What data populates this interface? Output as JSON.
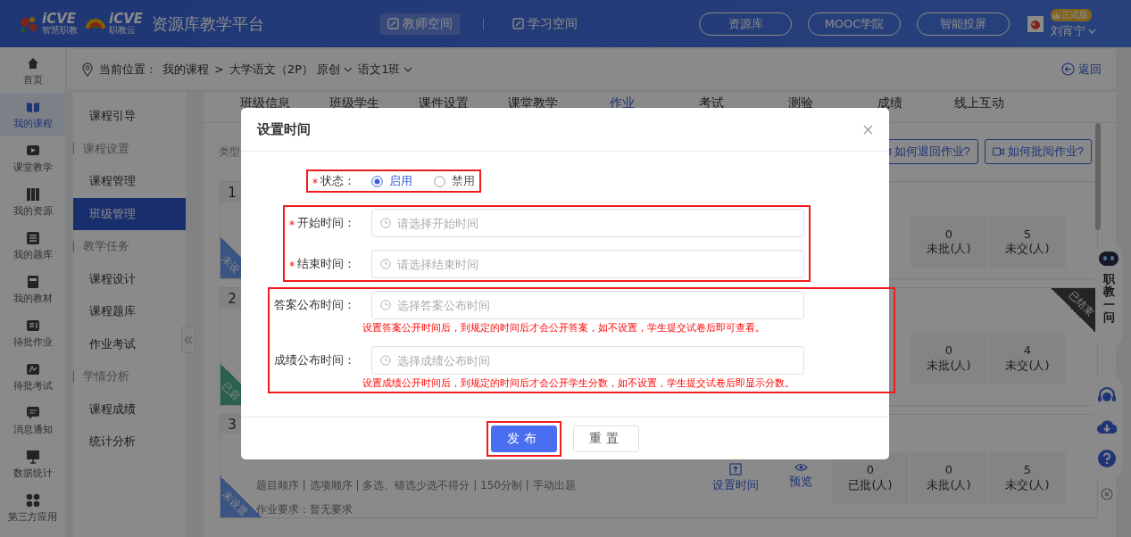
{
  "header": {
    "logos": [
      {
        "mark": "iCVE",
        "caption": "智慧职教"
      },
      {
        "mark": "iCVE",
        "caption": "职教云"
      }
    ],
    "title": "资源库教学平台",
    "spaces": [
      {
        "label": "教师空间",
        "selected": true
      },
      {
        "label": "学习空间",
        "selected": false
      }
    ],
    "links": [
      "资源库",
      "MOOC学院",
      "智能投屏"
    ],
    "badge": "正式版",
    "user": "刘宵宁"
  },
  "nav_rail": [
    {
      "label": "首页",
      "selected": false
    },
    {
      "label": "我的课程",
      "selected": true
    },
    {
      "label": "课堂教学",
      "selected": false
    },
    {
      "label": "我的资源",
      "selected": false
    },
    {
      "label": "我的题库",
      "selected": false
    },
    {
      "label": "我的教材",
      "selected": false
    },
    {
      "label": "待批作业",
      "selected": false
    },
    {
      "label": "待批考试",
      "selected": false
    },
    {
      "label": "消息通知",
      "selected": false
    },
    {
      "label": "数据统计",
      "selected": false
    },
    {
      "label": "第三方应用",
      "selected": false
    }
  ],
  "breadcrumb": {
    "label": "当前位置：",
    "crumbs": [
      {
        "text": "我的课程",
        "kind": "link"
      },
      {
        "text": ">",
        "kind": "separator"
      },
      {
        "text": "大学语文（2P） 原创",
        "kind": "dropdown"
      },
      {
        "text": "语文1班",
        "kind": "dropdown"
      }
    ],
    "back": "返回"
  },
  "course_menu": [
    {
      "label": "课程引导",
      "kind": "item",
      "selected": false
    },
    {
      "label": "课程设置",
      "kind": "section"
    },
    {
      "label": "课程管理",
      "kind": "item",
      "selected": false
    },
    {
      "label": "班级管理",
      "kind": "item",
      "selected": true
    },
    {
      "label": "教学任务",
      "kind": "section"
    },
    {
      "label": "课程设计",
      "kind": "item",
      "selected": false
    },
    {
      "label": "课程题库",
      "kind": "item",
      "selected": false
    },
    {
      "label": "作业考试",
      "kind": "item",
      "selected": false
    },
    {
      "label": "学情分析",
      "kind": "section"
    },
    {
      "label": "课程成绩",
      "kind": "item",
      "selected": false
    },
    {
      "label": "统计分析",
      "kind": "item",
      "selected": false
    }
  ],
  "tabs": [
    {
      "label": "班级信息",
      "selected": false
    },
    {
      "label": "班级学生",
      "selected": false
    },
    {
      "label": "课件设置",
      "selected": false
    },
    {
      "label": "课堂教学",
      "selected": false
    },
    {
      "label": "作业",
      "selected": true
    },
    {
      "label": "考试",
      "selected": false
    },
    {
      "label": "测验",
      "selected": false
    },
    {
      "label": "成绩",
      "selected": false
    },
    {
      "label": "线上互动",
      "selected": false
    }
  ],
  "toolbar": {
    "filter_label": "类型",
    "help_buttons": [
      "如何退回作业?",
      "如何批阅作业?"
    ]
  },
  "cards": [
    {
      "number": "1",
      "ribbon": {
        "text": "未设",
        "kind": "unset"
      },
      "stats": [
        {
          "value": "0",
          "label": "未批(人)"
        },
        {
          "value": "5",
          "label": "未交(人)"
        }
      ]
    },
    {
      "number": "2",
      "ribbon": {
        "text": "已启",
        "kind": "enabled"
      },
      "corner": "已结束",
      "stats": [
        {
          "value": "0",
          "label": "未批(人)"
        },
        {
          "value": "4",
          "label": "未交(人)"
        }
      ]
    },
    {
      "number": "3",
      "ribbon": {
        "text": "未设置",
        "kind": "unset"
      },
      "details": "题目顺序 | 选项顺序 | 多选、错选少选不得分 | 150分制 | 手动出题",
      "requirement": "作业要求：暂无要求",
      "actions": [
        "设置时间",
        "预览"
      ],
      "stats": [
        {
          "value": "0",
          "label": "已批(人)"
        },
        {
          "value": "0",
          "label": "未批(人)"
        },
        {
          "value": "5",
          "label": "未交(人)"
        }
      ]
    }
  ],
  "assistant": {
    "label": "职教一问"
  },
  "dialog": {
    "title": "设置时间",
    "groups": [
      {
        "highlighted": true,
        "rows": [
          {
            "kind": "radio",
            "label": "状态：",
            "required": true,
            "options": [
              {
                "label": "启用",
                "selected": true
              },
              {
                "label": "禁用",
                "selected": false
              }
            ]
          }
        ]
      },
      {
        "highlighted": true,
        "rows": [
          {
            "kind": "time",
            "label": "开始时间：",
            "required": true,
            "placeholder": "请选择开始时间"
          },
          {
            "kind": "time",
            "label": "结束时间：",
            "required": true,
            "placeholder": "请选择结束时间"
          }
        ]
      },
      {
        "highlighted": true,
        "rows": [
          {
            "kind": "time",
            "label": "答案公布时间：",
            "required": false,
            "placeholder": "选择答案公布时间",
            "hint": "设置答案公开时间后，到规定的时间后才会公开答案，如不设置，学生提交试卷后即可查看。"
          },
          {
            "kind": "time",
            "label": "成绩公布时间：",
            "required": false,
            "placeholder": "选择成绩公布时间",
            "hint": "设置成绩公开时间后，到规定的时间后才会公开学生分数，如不设置，学生提交试卷后即显示分数。"
          }
        ]
      }
    ],
    "buttons": [
      {
        "label": "发布",
        "kind": "primary",
        "highlighted": true
      },
      {
        "label": "重置",
        "kind": "default",
        "highlighted": false
      }
    ]
  }
}
